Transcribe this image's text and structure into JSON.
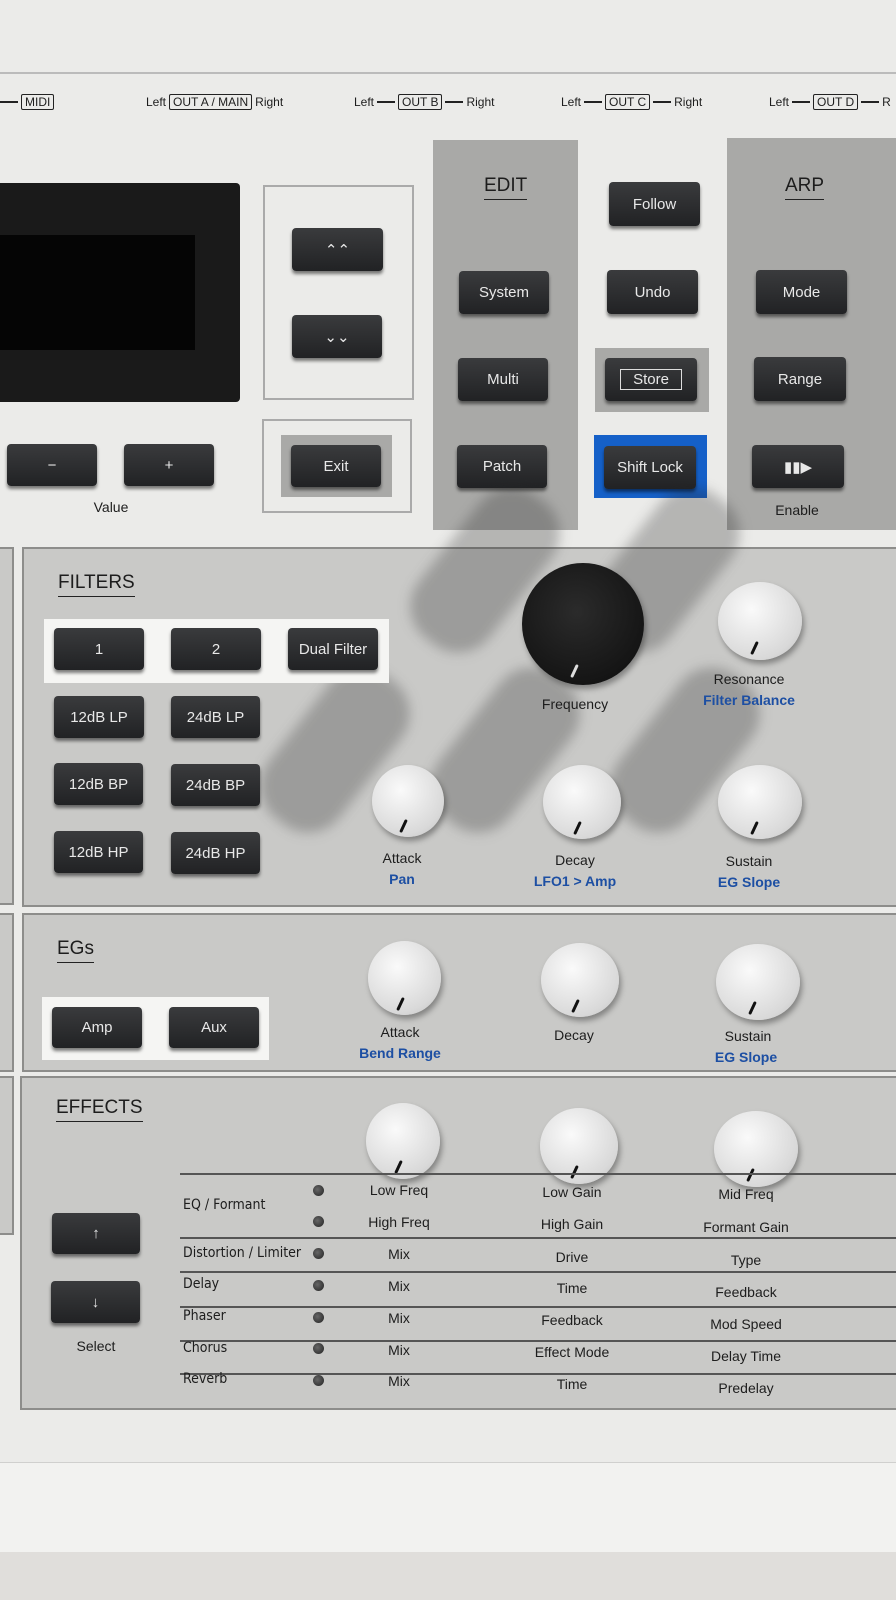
{
  "outputs": {
    "midi": "MIDI",
    "left": "Left",
    "right": "Right",
    "out_a": "OUT A / MAIN",
    "out_b": "OUT B",
    "out_c": "OUT C",
    "out_d": "OUT D"
  },
  "nav": {
    "up": "⌃⌃",
    "down": "⌄⌄",
    "exit": "Exit",
    "minus": "−",
    "plus": "+",
    "value": "Value"
  },
  "edit": {
    "title": "EDIT",
    "system": "System",
    "multi": "Multi",
    "patch": "Patch"
  },
  "mid": {
    "follow": "Follow",
    "undo": "Undo",
    "store": "Store",
    "shift_lock": "Shift Lock"
  },
  "arp": {
    "title": "ARP",
    "mode": "Mode",
    "range": "Range",
    "enable_icon": "▮▮▶",
    "enable": "Enable"
  },
  "filters": {
    "title": "FILTERS",
    "b1": "1",
    "b2": "2",
    "dual": "Dual Filter",
    "lp12": "12dB LP",
    "lp24": "24dB LP",
    "bp12": "12dB BP",
    "bp24": "24dB BP",
    "hp12": "12dB HP",
    "hp24": "24dB HP",
    "frequency": "Frequency",
    "resonance": "Resonance",
    "filter_balance": "Filter Balance",
    "attack": "Attack",
    "pan": "Pan",
    "decay": "Decay",
    "lfo_amp": "LFO1 > Amp",
    "sustain": "Sustain",
    "eg_slope": "EG Slope"
  },
  "egs": {
    "title": "EGs",
    "amp": "Amp",
    "aux": "Aux",
    "attack": "Attack",
    "bend_range": "Bend Range",
    "decay": "Decay",
    "sustain": "Sustain",
    "eg_slope": "EG Slope"
  },
  "effects": {
    "title": "EFFECTS",
    "up": "↑",
    "down": "↓",
    "select": "Select",
    "rows": [
      {
        "name": "EQ / Formant",
        "c1": "Low Freq",
        "c2": "Low Gain",
        "c3": "Mid Freq"
      },
      {
        "name": "",
        "c1": "High Freq",
        "c2": "High Gain",
        "c3": "Formant Gain"
      },
      {
        "name": "Distortion / Limiter",
        "c1": "Mix",
        "c2": "Drive",
        "c3": "Type"
      },
      {
        "name": "Delay",
        "c1": "Mix",
        "c2": "Time",
        "c3": "Feedback"
      },
      {
        "name": "Phaser",
        "c1": "Mix",
        "c2": "Feedback",
        "c3": "Mod Speed"
      },
      {
        "name": "Chorus",
        "c1": "Mix",
        "c2": "Effect Mode",
        "c3": "Delay Time"
      },
      {
        "name": "Reverb",
        "c1": "Mix",
        "c2": "Time",
        "c3": "Predelay"
      }
    ]
  },
  "colors": {
    "shift_lock": "#1560c8",
    "panel": "#c9c9c7"
  }
}
